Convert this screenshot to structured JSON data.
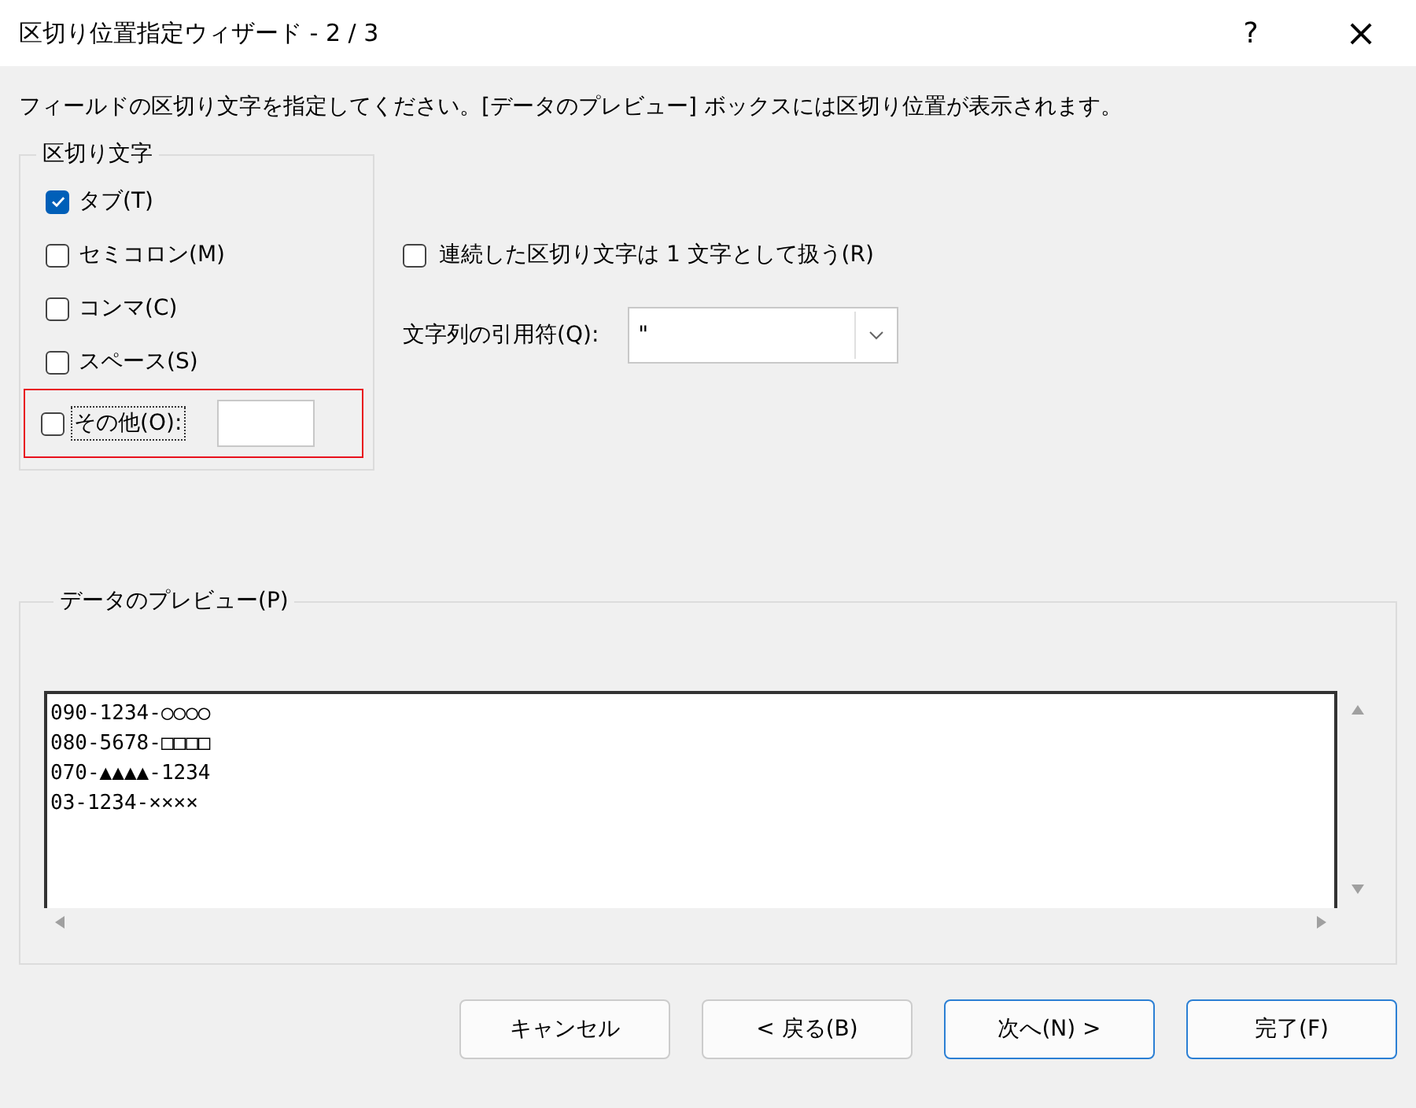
{
  "window": {
    "title": "区切り位置指定ウィザード - 2 / 3",
    "help": "?",
    "close": "×"
  },
  "instruction": "フィールドの区切り文字を指定してください。[データのプレビュー] ボックスには区切り位置が表示されます。",
  "delimiters": {
    "title": "区切り文字",
    "items": [
      {
        "label": "タブ(T)",
        "checked": true,
        "kind": "plain"
      },
      {
        "label": "セミコロン(M)",
        "checked": false,
        "kind": "plain"
      },
      {
        "label": "コンマ(C)",
        "checked": false,
        "kind": "plain"
      },
      {
        "label": "スペース(S)",
        "checked": false,
        "kind": "plain"
      },
      {
        "label": "その他(O):",
        "checked": false,
        "highlighted": true,
        "kind": "other"
      }
    ]
  },
  "consecutive": {
    "label": "連続した区切り文字は 1 文字として扱う(R)",
    "checked": false
  },
  "qualifier": {
    "label": "文字列の引用符(Q):",
    "value": "\""
  },
  "preview": {
    "title": "データのプレビュー(P)",
    "lines": [
      "090-1234-○○○○",
      "080-5678-□□□□",
      "070-▲▲▲▲-1234",
      "03-1234-××××"
    ]
  },
  "buttons": [
    {
      "label": "キャンセル",
      "highlighted": false
    },
    {
      "label": "< 戻る(B)",
      "highlighted": false
    },
    {
      "label": "次へ(N) >",
      "highlighted": true
    },
    {
      "label": "完了(F)",
      "highlighted": true
    }
  ]
}
